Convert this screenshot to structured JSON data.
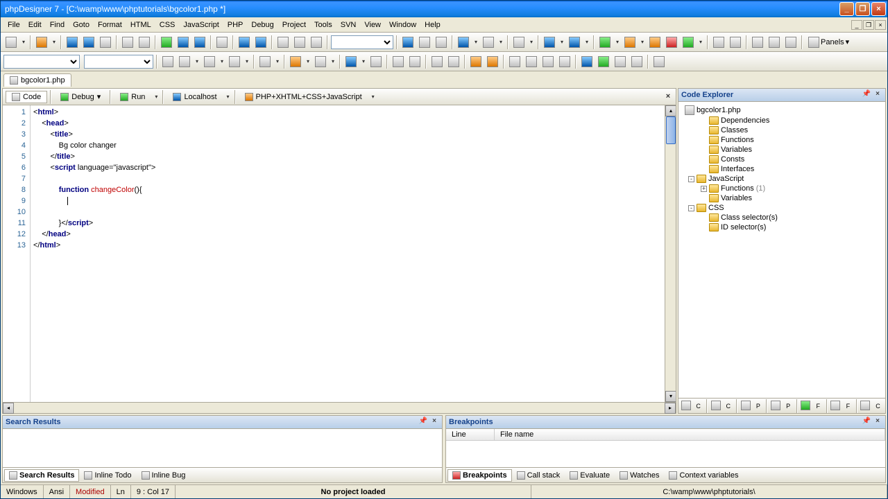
{
  "title": "phpDesigner 7 - [C:\\wamp\\www\\phptutorials\\bgcolor1.php *]",
  "menu": [
    "File",
    "Edit",
    "Find",
    "Goto",
    "Format",
    "HTML",
    "CSS",
    "JavaScript",
    "PHP",
    "Debug",
    "Project",
    "Tools",
    "SVN",
    "View",
    "Window",
    "Help"
  ],
  "panels_button": "Panels",
  "file_tab": "bgcolor1.php",
  "editor_toolbar": {
    "code": "Code",
    "debug": "Debug",
    "run": "Run",
    "localhost": "Localhost",
    "syntax": "PHP+XHTML+CSS+JavaScript"
  },
  "code_lines": [
    {
      "n": 1,
      "html": "&lt;<span class='kw'>html</span>&gt;"
    },
    {
      "n": 2,
      "html": "    &lt;<span class='kw'>head</span>&gt;"
    },
    {
      "n": 3,
      "html": "        &lt;<span class='kw'>title</span>&gt;"
    },
    {
      "n": 4,
      "html": "            Bg color changer"
    },
    {
      "n": 5,
      "html": "        &lt;/<span class='kw'>title</span>&gt;"
    },
    {
      "n": 6,
      "html": "        &lt;<span class='kw'>script</span> language=\"javascript\"&gt;"
    },
    {
      "n": 7,
      "html": ""
    },
    {
      "n": 8,
      "html": "            <span class='kw'>function</span> <span class='fn'>changeColor</span>(){"
    },
    {
      "n": 9,
      "html": "                <span class='cursor'></span>"
    },
    {
      "n": 10,
      "html": ""
    },
    {
      "n": 11,
      "html": "            }&lt;/<span class='kw'>script</span>&gt;"
    },
    {
      "n": 12,
      "html": "    &lt;/<span class='kw'>head</span>&gt;"
    },
    {
      "n": 13,
      "html": "&lt;/<span class='kw'>html</span>&gt;"
    }
  ],
  "explorer": {
    "title": "Code Explorer",
    "file": "bgcolor1.php",
    "nodes": [
      {
        "indent": 1,
        "exp": "",
        "label": "Dependencies"
      },
      {
        "indent": 1,
        "exp": "",
        "label": "Classes"
      },
      {
        "indent": 1,
        "exp": "",
        "label": "Functions"
      },
      {
        "indent": 1,
        "exp": "",
        "label": "Variables"
      },
      {
        "indent": 1,
        "exp": "",
        "label": "Consts"
      },
      {
        "indent": 1,
        "exp": "",
        "label": "Interfaces"
      },
      {
        "indent": 0,
        "exp": "-",
        "label": "JavaScript"
      },
      {
        "indent": 1,
        "exp": "+",
        "label": "Functions",
        "count": "(1)"
      },
      {
        "indent": 1,
        "exp": "",
        "label": "Variables"
      },
      {
        "indent": 0,
        "exp": "-",
        "label": "CSS"
      },
      {
        "indent": 1,
        "exp": "",
        "label": "Class selector(s)"
      },
      {
        "indent": 1,
        "exp": "",
        "label": "ID selector(s)"
      }
    ]
  },
  "search_results": {
    "title": "Search Results",
    "tabs": [
      "Search Results",
      "Inline Todo",
      "Inline Bug"
    ]
  },
  "breakpoints": {
    "title": "Breakpoints",
    "columns": [
      "Line",
      "File name"
    ],
    "tabs": [
      "Breakpoints",
      "Call stack",
      "Evaluate",
      "Watches",
      "Context variables"
    ]
  },
  "statusbar": {
    "os": "Windows",
    "enc": "Ansi",
    "modified": "Modified",
    "ln": "Ln",
    "pos": "9 : Col   17",
    "project": "No project loaded",
    "path": "C:\\wamp\\www\\phptutorials\\"
  }
}
